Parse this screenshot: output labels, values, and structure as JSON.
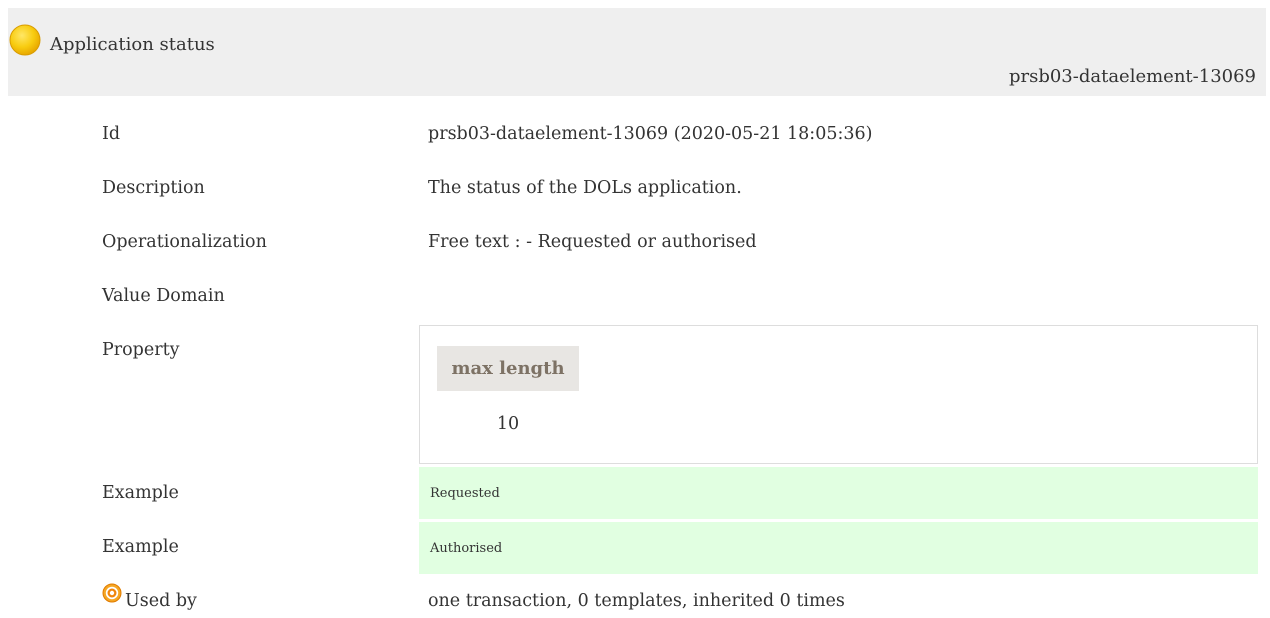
{
  "header": {
    "title": "Application status",
    "id": "prsb03-dataelement-13069",
    "status_icon": "yellow-status-dot-icon",
    "status_color": "#f5c400"
  },
  "rows": {
    "id": {
      "label": "Id",
      "value": "prsb03-dataelement-13069 (2020-05-21 18:05:36)"
    },
    "description": {
      "label": "Description",
      "value": "The status of the DOLs application."
    },
    "operationalization": {
      "label": "Operationalization",
      "value": "Free text : - Requested or authorised"
    },
    "value_domain": {
      "label": "Value Domain"
    },
    "property": {
      "label": "Property",
      "column_header": "max length",
      "column_value": "10"
    },
    "examples": [
      {
        "label": "Example",
        "value": "Requested"
      },
      {
        "label": "Example",
        "value": "Authorised"
      }
    ],
    "used_by": {
      "label": "Used by",
      "value": "one transaction, 0 templates, inherited 0 times",
      "icon": "target-icon"
    }
  },
  "colors": {
    "header_bg": "#efefef",
    "example_bg": "#e1ffe1",
    "property_header_bg": "#e8e6e3",
    "property_header_text": "#7d7265",
    "used_by_icon": "#f0860c"
  }
}
